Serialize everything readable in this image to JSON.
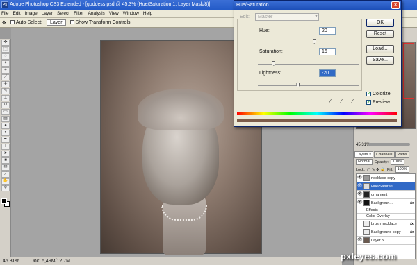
{
  "app": {
    "title": "Adobe Photoshop CS3 Extended - [goddess.psd @ 45,3% (Hue/Saturation 1, Layer Mask/8)]",
    "logo_text": "Ps"
  },
  "menu": [
    "File",
    "Edit",
    "Image",
    "Layer",
    "Select",
    "Filter",
    "Analysis",
    "View",
    "Window",
    "Help"
  ],
  "options_bar": {
    "auto_select_label": "Auto-Select:",
    "auto_select_value": "Layer",
    "show_transform_label": "Show Transform Controls"
  },
  "status_bar": {
    "zoom": "45.31%",
    "doc": "Doc: 5,49M/12,7M"
  },
  "dialog": {
    "title": "Hue/Saturation",
    "edit_label": "Edit:",
    "edit_value": "Master",
    "hue_label": "Hue:",
    "hue_value": "20",
    "saturation_label": "Saturation:",
    "saturation_value": "16",
    "lightness_label": "Lightness:",
    "lightness_value": "-20",
    "ok_label": "OK",
    "reset_label": "Reset",
    "load_label": "Load...",
    "save_label": "Save...",
    "colorize_label": "Colorize",
    "colorize_checked": true,
    "preview_label": "Preview",
    "preview_checked": true,
    "hue_level": 0.56,
    "saturation_level": 0.16,
    "lightness_level": 0.4
  },
  "navigator": {
    "zoom": "45.31%"
  },
  "layers_panel": {
    "tabs": [
      "Layers ×",
      "Channels",
      "Paths"
    ],
    "blend_mode": "Normal",
    "opacity_label": "Opacity:",
    "opacity_value": "100%",
    "lock_label": "Lock:",
    "fill_label": "Fill:",
    "fill_value": "100%",
    "layers": [
      {
        "name": "necklace copy",
        "fx": ""
      },
      {
        "name": "Hue/Saturati...",
        "fx": "",
        "selected": true
      },
      {
        "name": "ornament",
        "fx": ""
      },
      {
        "name": "Backgroun...",
        "fx": "fx"
      },
      {
        "name": "Effects",
        "fx": "",
        "sub": true
      },
      {
        "name": "Color Overlay",
        "fx": "",
        "sub": true
      },
      {
        "name": "brush necklace",
        "fx": "fx"
      },
      {
        "name": "Background copy",
        "fx": "fx"
      },
      {
        "name": "Layer 5",
        "fx": ""
      }
    ]
  },
  "watermark": "pxleyes.com",
  "colors": {
    "titlebar": "#245bc8",
    "selected_layer": "#3169c6",
    "chrome": "#ece9d8"
  }
}
